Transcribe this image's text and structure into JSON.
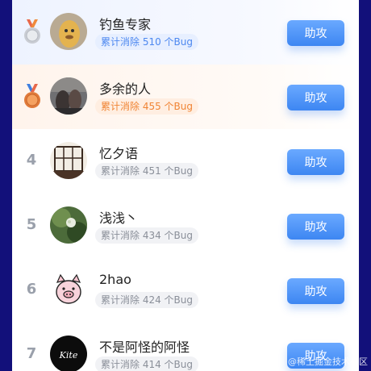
{
  "rows": [
    {
      "rank": "",
      "medal": "silver",
      "name": "钓鱼专家",
      "count_text": "累计消除 510 个Bug",
      "button": "助攻"
    },
    {
      "rank": "",
      "medal": "bronze",
      "name": "多余的人",
      "count_text": "累计消除 455 个Bug",
      "button": "助攻"
    },
    {
      "rank": "4",
      "name": "忆夕语",
      "count_text": "累计消除 451 个Bug",
      "button": "助攻"
    },
    {
      "rank": "5",
      "name": "浅浅丶",
      "count_text": "累计消除 434 个Bug",
      "button": "助攻"
    },
    {
      "rank": "6",
      "name": "2hao",
      "count_text": "累计消除 424 个Bug",
      "button": "助攻"
    },
    {
      "rank": "7",
      "name": "不是阿怪的阿怪",
      "count_text": "累计消除 414 个Bug",
      "button": "助攻",
      "avatar_text": "Kite"
    }
  ],
  "watermark": "@稀土掘金技术社区",
  "colors": {
    "page_bg": "#12107a",
    "accent_blue": "#3d86f2",
    "accent_orange": "#f08434"
  }
}
